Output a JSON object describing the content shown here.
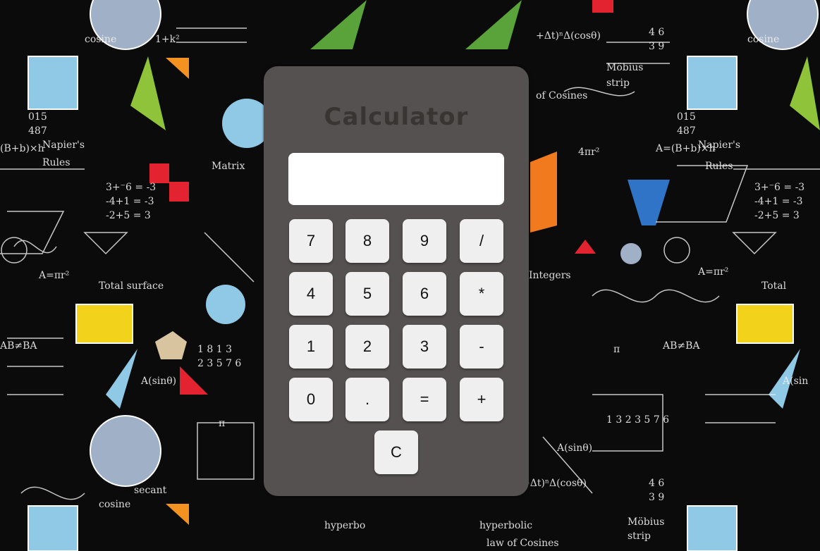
{
  "calculator": {
    "title": "Calculator",
    "display_value": "",
    "buttons": {
      "b7": "7",
      "b8": "8",
      "b9": "9",
      "div": "/",
      "b4": "4",
      "b5": "5",
      "b6": "6",
      "mul": "*",
      "b1": "1",
      "b2": "2",
      "b3": "3",
      "sub": "-",
      "b0": "0",
      "dot": ".",
      "eq": "=",
      "add": "+",
      "clear": "C"
    }
  },
  "colors": {
    "panel": "#555150",
    "button": "#efefef",
    "display": "#ffffff",
    "title": "#383533"
  }
}
